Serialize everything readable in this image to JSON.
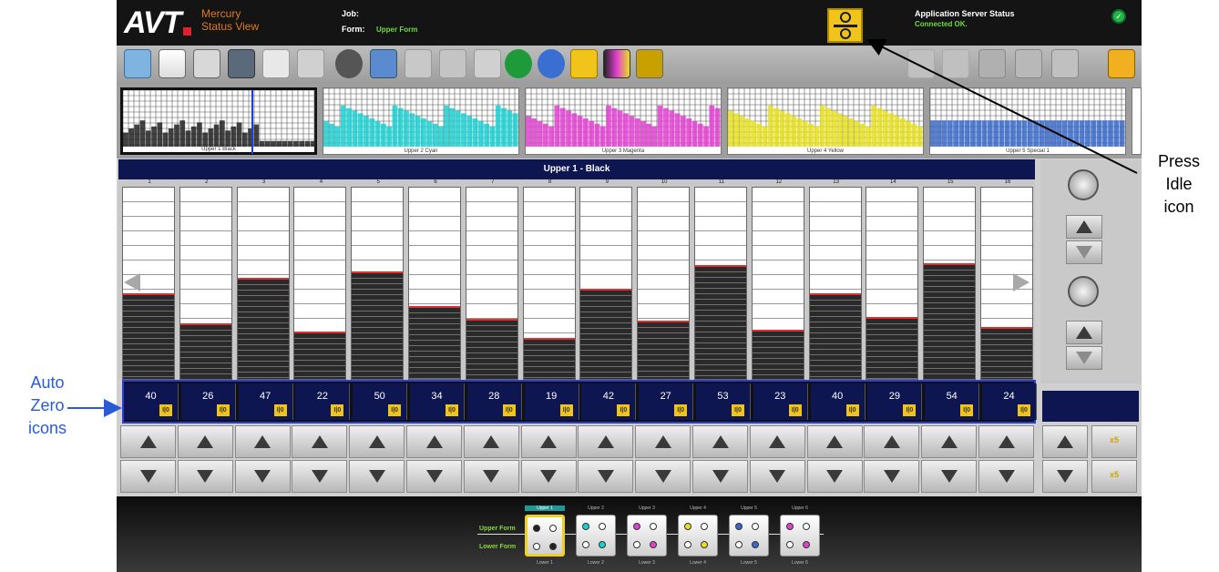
{
  "header": {
    "logo": "AVT",
    "app_name_line1": "Mercury",
    "app_name_line2": "Status View",
    "job_label": "Job:",
    "job_value": "",
    "form_label": "Form:",
    "form_value": "Upper Form",
    "server_status_label": "Application Server Status",
    "server_status_value": "Connected OK."
  },
  "thumbnails": [
    {
      "label": "Upper 1 Black",
      "color": "#222222",
      "selected": true
    },
    {
      "label": "Upper 2 Cyan",
      "color": "#1ccfd0",
      "selected": false
    },
    {
      "label": "Upper 3 Magenta",
      "color": "#e040d0",
      "selected": false
    },
    {
      "label": "Upper 4 Yellow",
      "color": "#e8e020",
      "selected": false
    },
    {
      "label": "Upper 5 Special 1",
      "color": "#3a68c8",
      "selected": false
    }
  ],
  "channel_title": "Upper 1 - Black",
  "channels": [
    {
      "num": "1",
      "value": "40"
    },
    {
      "num": "2",
      "value": "26"
    },
    {
      "num": "3",
      "value": "47"
    },
    {
      "num": "4",
      "value": "22"
    },
    {
      "num": "5",
      "value": "50"
    },
    {
      "num": "6",
      "value": "34"
    },
    {
      "num": "7",
      "value": "28"
    },
    {
      "num": "8",
      "value": "19"
    },
    {
      "num": "9",
      "value": "42"
    },
    {
      "num": "10",
      "value": "27"
    },
    {
      "num": "11",
      "value": "53"
    },
    {
      "num": "12",
      "value": "23"
    },
    {
      "num": "13",
      "value": "40"
    },
    {
      "num": "14",
      "value": "29"
    },
    {
      "num": "15",
      "value": "54"
    },
    {
      "num": "16",
      "value": "24"
    }
  ],
  "auto_zero_label": "I|0",
  "x5_up_label": "x5",
  "x5_down_label": "x5",
  "footer": {
    "upper_form_label": "Upper Form",
    "lower_form_label": "Lower Form",
    "units": [
      {
        "top": "Upper 1",
        "bottom": "Lower 1",
        "color": "#222222"
      },
      {
        "top": "Upper 2",
        "bottom": "Lower 2",
        "color": "#1ccfd0"
      },
      {
        "top": "Upper 3",
        "bottom": "Lower 3",
        "color": "#e040d0"
      },
      {
        "top": "Upper 4",
        "bottom": "Lower 4",
        "color": "#e8e020"
      },
      {
        "top": "Upper 5",
        "bottom": "Lower 5",
        "color": "#3a68c8"
      },
      {
        "top": "Upper 6",
        "bottom": "Lower 6",
        "color": "#e040d0"
      }
    ]
  },
  "annotations": {
    "press_idle": [
      "Press",
      "Idle",
      "icon"
    ],
    "auto_zero": [
      "Auto",
      "Zero",
      "icons"
    ]
  },
  "icons": [
    "start-icon",
    "new-icon",
    "edit-icon",
    "save-icon",
    "stop-icon",
    "view-icon",
    "percent-icon",
    "copy-icon",
    "paste-icon",
    "refresh-icon",
    "ratio-icon",
    "ok-icon",
    "lock-icon",
    "ink-icon",
    "transfer-icon",
    "undo-icon",
    "chart-icon",
    "plate-icon",
    "tools-icon",
    "io-icon",
    "padlock-icon"
  ]
}
